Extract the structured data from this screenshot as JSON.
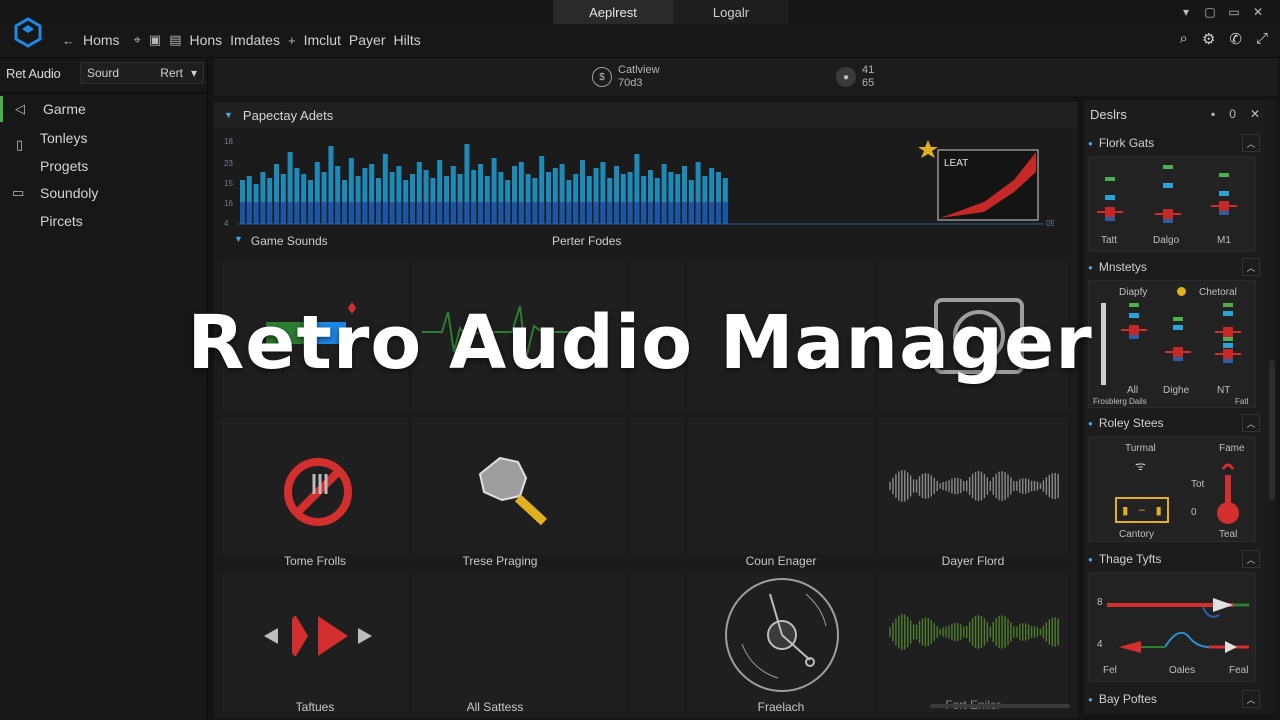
{
  "titlebar": {
    "tabs": [
      "Aeplrest",
      "Logalr"
    ]
  },
  "toolbar": {
    "items": [
      "Homs",
      "Hons",
      "Imdates",
      "Imclut",
      "Payer",
      "Hilts"
    ]
  },
  "sidebar": {
    "label": "Ret Audio",
    "select_value": "Sourd",
    "select_option": "Rert",
    "items": [
      "Garme",
      "Tonleys",
      "Progets",
      "Soundoly",
      "Pircets"
    ]
  },
  "stats": {
    "one_label": "Catlview",
    "one_value": "70d3",
    "two_label": "41",
    "two_value": "65"
  },
  "assets": {
    "title": "Papectay Adets",
    "wave_y_ticks": [
      "18",
      "23",
      "15",
      "16",
      "4"
    ],
    "wave_x_tick": "05",
    "inset_label": "LEAT",
    "group_label": "Game Sounds",
    "group_label2": "Perter Fodes",
    "tiles": [
      {
        "label": "Tome Frolls"
      },
      {
        "label": "Trese Praging"
      },
      {
        "label": "Coun Enager"
      },
      {
        "label": "Dayer Flord"
      },
      {
        "label": "Taftues"
      },
      {
        "label": "All Sattess"
      },
      {
        "label": "Fraelach"
      },
      {
        "label": "Fort Eniler"
      }
    ]
  },
  "rpanel": {
    "title": "Deslrs",
    "ctrl_num": "0",
    "sections": [
      {
        "title": "Flork Gats",
        "labels": [
          "Tatt",
          "Dalgo",
          "M1"
        ]
      },
      {
        "title": "Mnstetys",
        "labels": [
          "Diapfy",
          "Chetoral",
          "All",
          "Dighe",
          "NT",
          "Frosblerg Dails",
          "Fatl"
        ]
      },
      {
        "title": "Roley Stees",
        "labels": [
          "Turmal",
          "Fame",
          "Tot",
          "0",
          "Cantory",
          "Teal"
        ]
      },
      {
        "title": "Thage Tyfts",
        "labels": [
          "8",
          "4",
          "Fel",
          "Oales",
          "Feal"
        ]
      },
      {
        "title": "Bay Poftes"
      }
    ]
  },
  "overlay": {
    "title": "Retro Audio Manager"
  },
  "colors": {
    "accent_blue": "#1e88e5",
    "accent_green": "#4caf50",
    "accent_red": "#d32f2f",
    "accent_yellow": "#e0b020"
  }
}
